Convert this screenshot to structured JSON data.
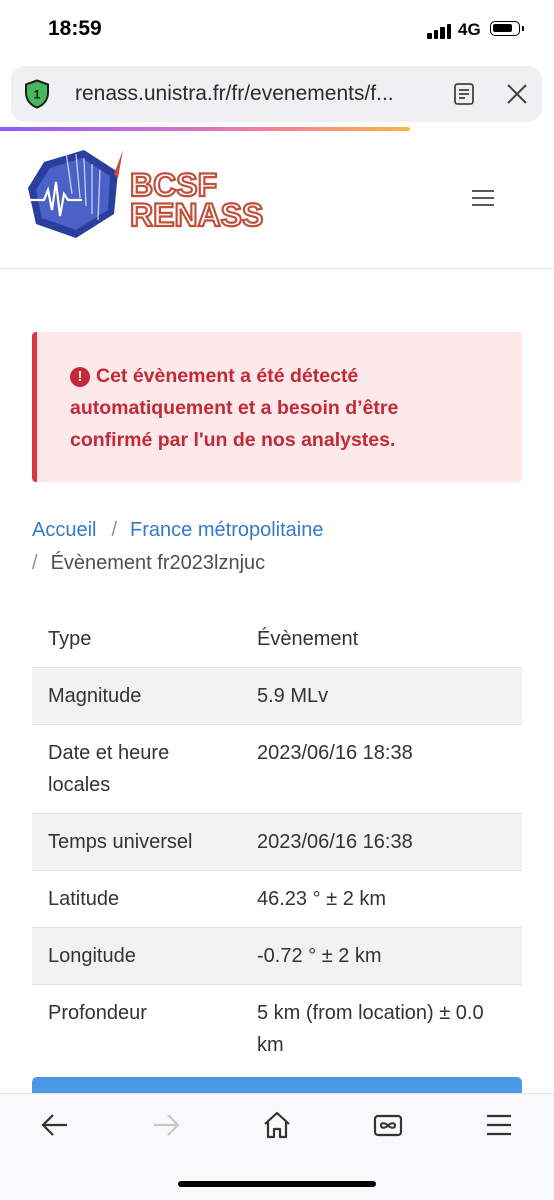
{
  "status_bar": {
    "time": "18:59",
    "network": "4G"
  },
  "browser": {
    "tab_count": "1",
    "url": "renass.unistra.fr/fr/evenements/f...",
    "load_progress_percent": 74
  },
  "header": {
    "logo_line1": "BCSF",
    "logo_line2": "RENASS"
  },
  "alert": {
    "message": "Cet évènement a été détecté automatiquement et a besoin d’être confirmé par l'un de nos analystes."
  },
  "breadcrumb": {
    "home": "Accueil",
    "region": "France métropolitaine",
    "separator": "/",
    "current": "Évènement fr2023lznjuc"
  },
  "event_table": [
    {
      "label": "Type",
      "value": "Évènement"
    },
    {
      "label": "Magnitude",
      "value": "5.9 MLv"
    },
    {
      "label": "Date et heure locales",
      "value": "2023/06/16 18:38"
    },
    {
      "label": "Temps universel",
      "value": "2023/06/16 16:38"
    },
    {
      "label": "Latitude",
      "value": "46.23 ° ± 2 km"
    },
    {
      "label": "Longitude",
      "value": "-0.72 ° ± 2 km"
    },
    {
      "label": "Profondeur",
      "value": "5 km (from location) ± 0.0 km"
    }
  ],
  "colors": {
    "alert_text": "#c4293a",
    "alert_bg": "#fde8ea",
    "link": "#3579c9",
    "logo_red": "#c0503a",
    "logo_blue": "#2a3f9d",
    "button_blue": "#4a98e6"
  },
  "icons": {
    "shield": "shield-icon",
    "reader": "reader-mode-icon",
    "close": "close-icon",
    "back": "back-arrow-icon",
    "forward": "forward-arrow-icon",
    "home": "home-icon",
    "tabs": "tabs-icon",
    "menu": "menu-icon"
  }
}
